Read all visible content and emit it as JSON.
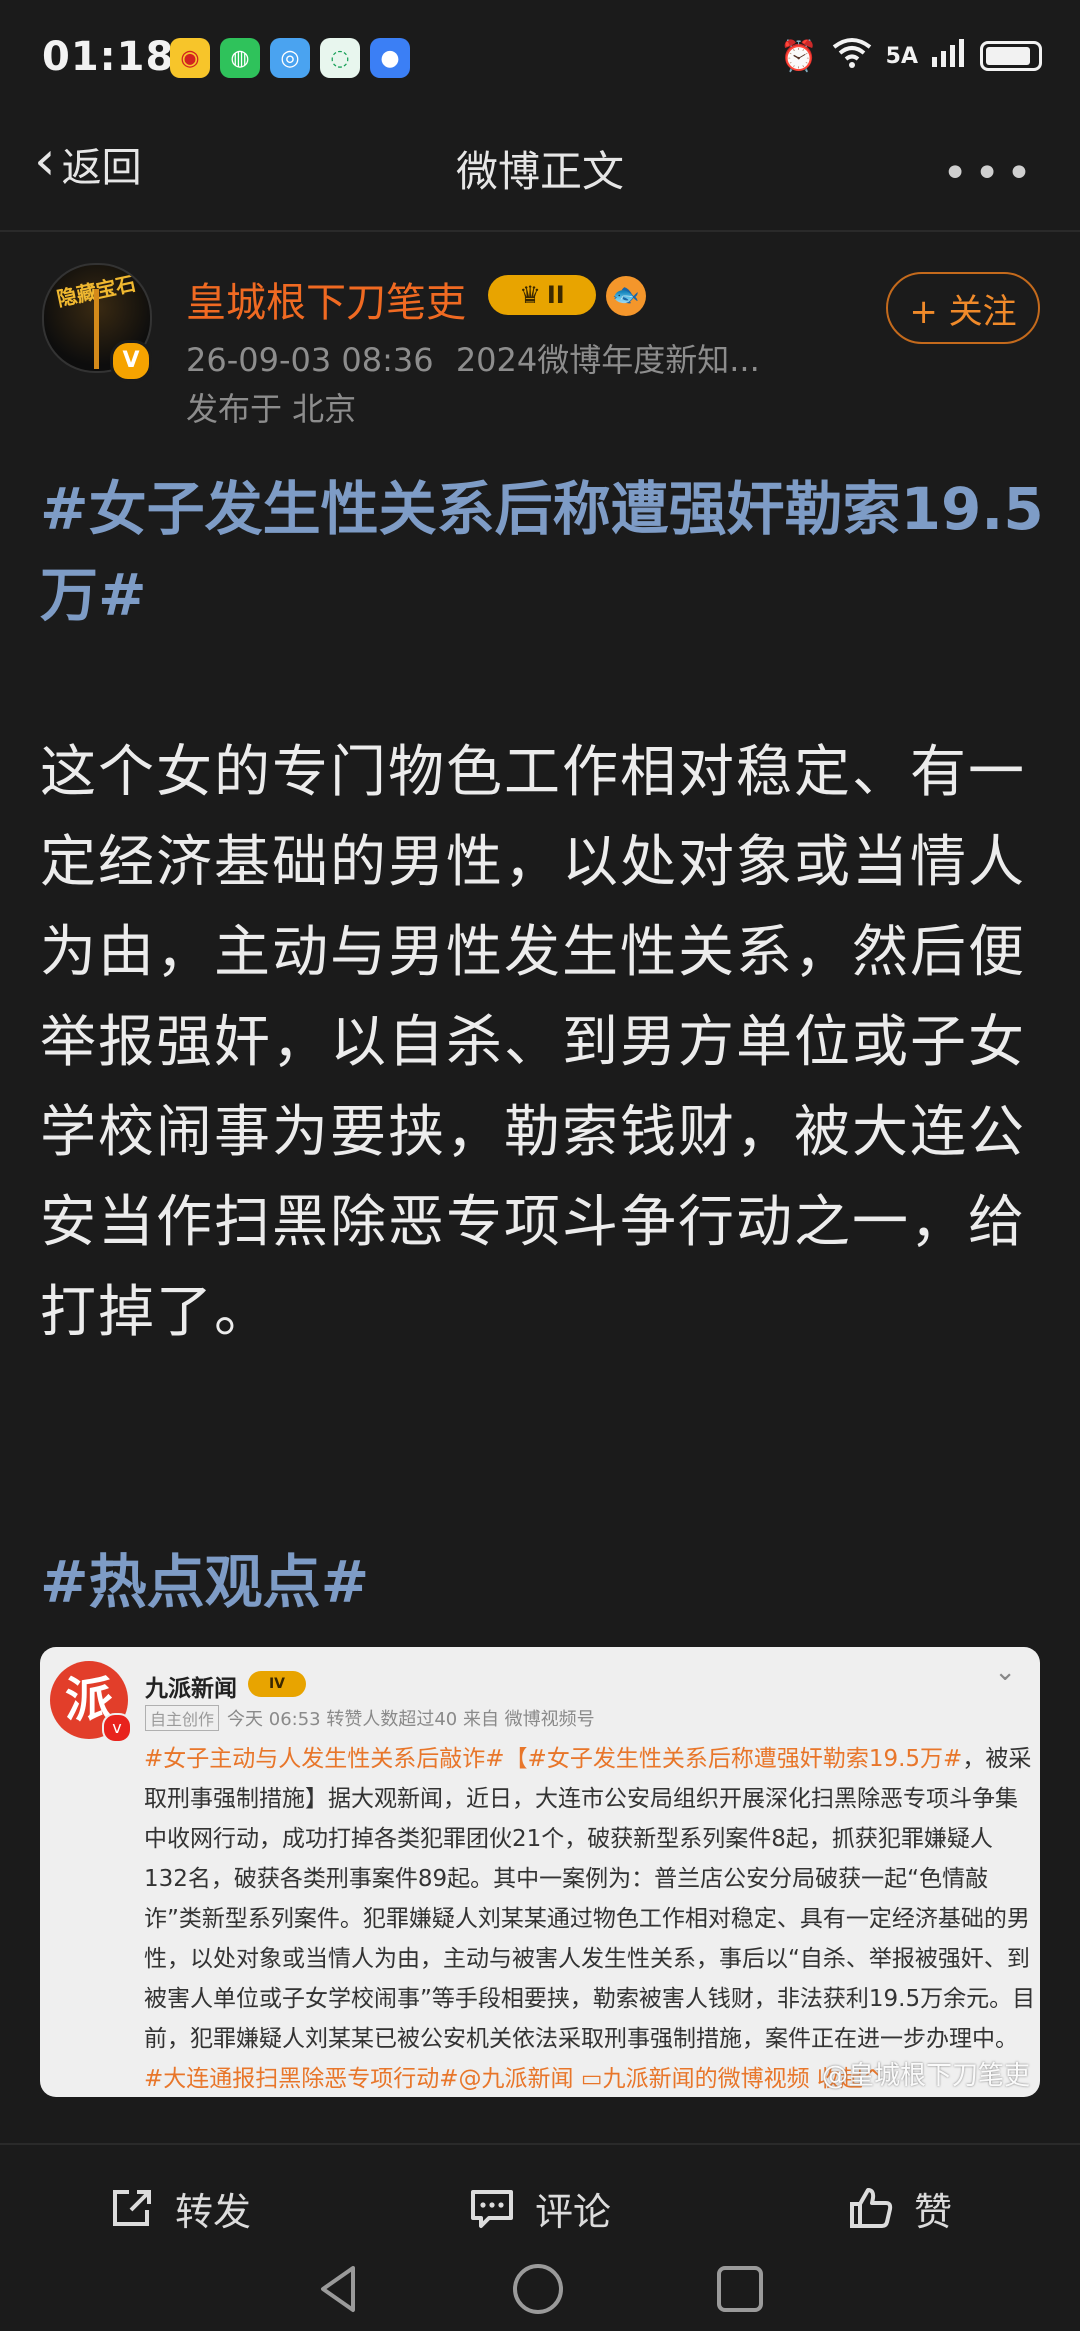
{
  "status_bar": {
    "time": "01:18",
    "network": "5A",
    "apps": [
      "weibo-icon",
      "wechat-icon",
      "browser-icon",
      "messages-icon",
      "chat-icon"
    ]
  },
  "nav": {
    "back_label": "返回",
    "title": "微博正文"
  },
  "author": {
    "avatar_text": "隐藏宝石",
    "name": "皇城根下刀笔吏",
    "level_badge": "II",
    "date": "26-09-03 08:36",
    "source": "2024微博年度新知...",
    "location": "发布于 北京",
    "follow_label": "+ 关注"
  },
  "post": {
    "hashtag_title": "#女子发生性关系后称遭强奸勒索19.5万#",
    "body": "这个女的专门物色工作相对稳定、有一定经济基础的男性，以处对象或当情人为由，主动与男性发生性关系，然后便举报强奸，以自杀、到男方单位或子女学校闹事为要挟，勒索钱财，被大连公安当作扫黑除恶专项斗争行动之一，给打掉了。",
    "hot_tag": "#热点观点#"
  },
  "embedded": {
    "logo_text": "派",
    "name": "九派新闻",
    "badge": "IV",
    "tag": "自主创作",
    "meta": "今天 06:53 转赞人数超过40  来自 微博视频号",
    "hashtag1": "#女子主动与人发生性关系后敲诈#",
    "hashtag2": "【#女子发生性关系后称遭强奸勒索19.5万#",
    "text": "，被采取刑事强制措施】据大观新闻，近日，大连市公安局组织开展深化扫黑除恶专项斗争集中收网行动，成功打掉各类犯罪团伙21个，破获新型系列案件8起，抓获犯罪嫌疑人132名，破获各类刑事案件89起。其中一案例为：普兰店公安分局破获一起“色情敲诈”类新型系列案件。犯罪嫌疑人刘某某通过物色工作相对稳定、具有一定经济基础的男性，以处对象或当情人为由，主动与被害人发生性关系，事后以“自杀、举报被强奸、到被害人单位或子女学校闹事”等手段相要挟，勒索被害人钱财，非法获利19.5万余元。目前，犯罪嫌疑人刘某某已被公安机关依法采取刑事强制措施，案件正在进一步办理中。",
    "hashtag3": "#大连通报扫黑除恶专项行动#@九派新闻",
    "video_link": "九派新闻的微博视频",
    "collapse": "收起^",
    "watermark": "@皇城根下刀笔吏"
  },
  "actions": {
    "repost": "转发",
    "comment": "评论",
    "like": "赞"
  },
  "colors": {
    "background": "#1b1b1b",
    "hashtag": "#7e9cc6",
    "author_name": "#f06a22",
    "follow": "#f08a2a"
  }
}
